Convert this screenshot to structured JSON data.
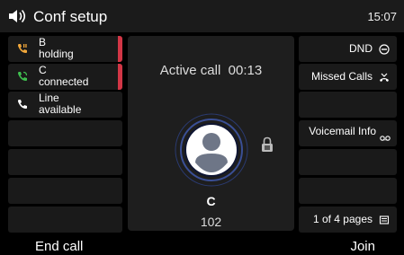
{
  "header": {
    "title": "Conf setup",
    "time": "15:07",
    "icon": "speaker-icon"
  },
  "line_keys": [
    {
      "line1": "B",
      "line2": "holding",
      "icon": "phone-hold-icon",
      "icon_color": "#f2a83b",
      "status_color": "#d23646"
    },
    {
      "line1": "C",
      "line2": "connected",
      "icon": "phone-connected-icon",
      "icon_color": "#3fbf4f",
      "status_color": "#d23646"
    },
    {
      "line1": "Line",
      "line2": "available",
      "icon": "phone-icon",
      "icon_color": "#ffffff"
    }
  ],
  "call": {
    "status": "Active call",
    "duration": "00:13",
    "name": "C",
    "number": "102"
  },
  "right_keys": [
    {
      "label": "DND",
      "icon": "dnd-icon"
    },
    {
      "label": "Missed Calls",
      "icon": "missed-calls-icon"
    },
    {
      "label": "",
      "icon": ""
    },
    {
      "label": "Voicemail Info",
      "icon": "voicemail-icon"
    },
    {
      "label": "",
      "icon": ""
    },
    {
      "label": "",
      "icon": ""
    },
    {
      "label": "1 of 4 pages",
      "icon": "pages-icon"
    }
  ],
  "softkeys": {
    "left": "End call",
    "right": "Join"
  }
}
